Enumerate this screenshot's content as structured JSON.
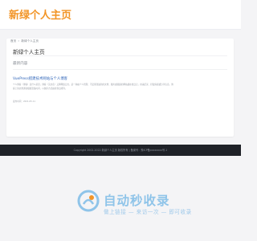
{
  "header": {
    "site_title": "新绿个人主页"
  },
  "breadcrumb": {
    "home": "首页",
    "separator": "»",
    "current": "新绿个人主页"
  },
  "card": {
    "title": "新绿个人主页",
    "section_label": "最新内容",
    "post": {
      "title": "VuePress搭建技术网站与个人博客",
      "excerpt": "个人博客（博客）是什么意思，博客（英文名）又称网络日志，是一种由个人管理、不定期张贴新的文章、图片或视频的网站或在线日记，用来纪录、抒发情感或分享信息。博客上的文章通常根据张贴时间，以倒序方式由新到旧排列。",
      "date": "发布时间：2021-05-11"
    }
  },
  "footer": {
    "text": "Copyright 2002-2022 新绿个人主页 版权所有 | 备案号：豫ICP备xxxxxxxx号-1"
  },
  "watermark": {
    "brand": "自动秒收录",
    "slogan": "做上链接 — 来访一次 — 即可收录",
    "accent_color": "#8fc4e9"
  },
  "colors": {
    "logo": "#f29527",
    "link": "#2e64b8",
    "footer_bg": "#1f2228"
  }
}
